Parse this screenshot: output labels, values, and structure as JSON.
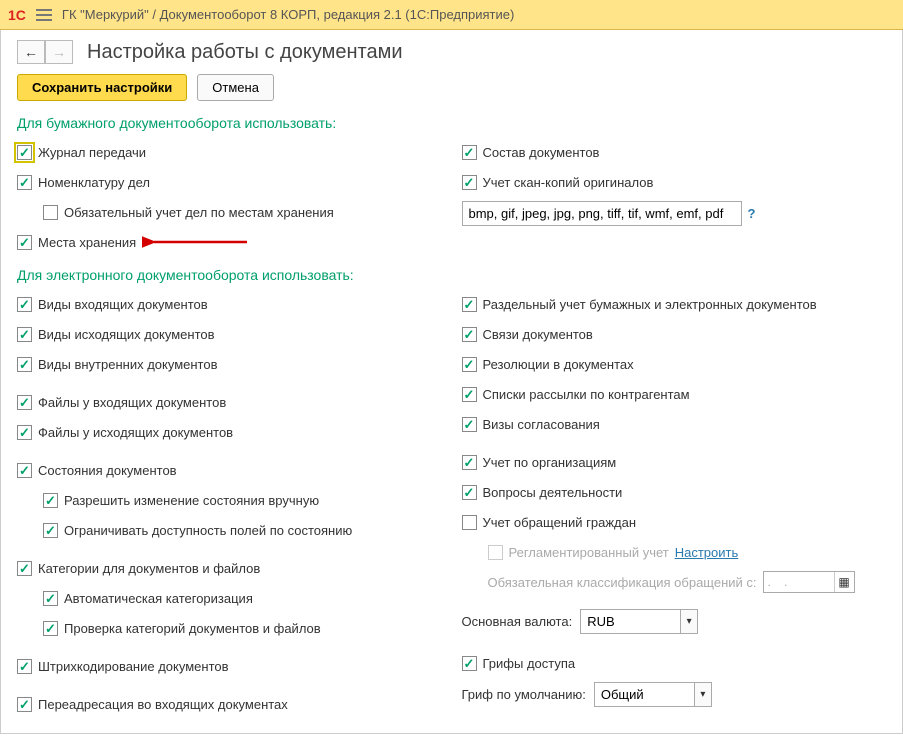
{
  "titlebar": {
    "app": "ГК \"Меркурий\" / Документооборот 8 КОРП, редакция 2.1  (1С:Предприятие)"
  },
  "page": {
    "title": "Настройка работы с документами",
    "save": "Сохранить настройки",
    "cancel": "Отмена"
  },
  "sections": {
    "paper": "Для бумажного документооборота использовать:",
    "electronic": "Для электронного документооборота использовать:"
  },
  "left": {
    "journal": "Журнал передачи",
    "nomenclature": "Номенклатуру дел",
    "mandatory_storage": "Обязательный учет дел по местам хранения",
    "storage_places": "Места хранения",
    "incoming_types": "Виды входящих документов",
    "outgoing_types": "Виды исходящих документов",
    "internal_types": "Виды внутренних документов",
    "files_incoming": "Файлы у входящих документов",
    "files_outgoing": "Файлы у исходящих документов",
    "states": "Состояния документов",
    "states_manual": "Разрешить изменение состояния вручную",
    "states_restrict": "Ограничивать доступность полей по состоянию",
    "categories": "Категории для документов и файлов",
    "auto_cat": "Автоматическая категоризация",
    "check_cat": "Проверка категорий документов и файлов",
    "barcode": "Штрихкодирование документов",
    "readdress": "Переадресация во входящих документах"
  },
  "right": {
    "composition": "Состав документов",
    "scan_copies": "Учет скан-копий оригиналов",
    "formats": "bmp, gif, jpeg, jpg, png, tiff, tif, wmf, emf, pdf",
    "help": "?",
    "separate": "Раздельный учет бумажных и электронных документов",
    "links": "Связи документов",
    "resolutions": "Резолюции в документах",
    "mailing": "Списки рассылки по контрагентам",
    "visas": "Визы согласования",
    "by_org": "Учет по организациям",
    "activities": "Вопросы деятельности",
    "citizens": "Учет обращений граждан",
    "regulated": "Регламентированный учет",
    "configure": "Настроить",
    "classification_from": "Обязательная классификация обращений с:",
    "date_placeholder": ".    .",
    "currency_label": "Основная валюта:",
    "currency_value": "RUB",
    "access_stamps": "Грифы доступа",
    "default_stamp_label": "Гриф по умолчанию:",
    "default_stamp_value": "Общий"
  }
}
